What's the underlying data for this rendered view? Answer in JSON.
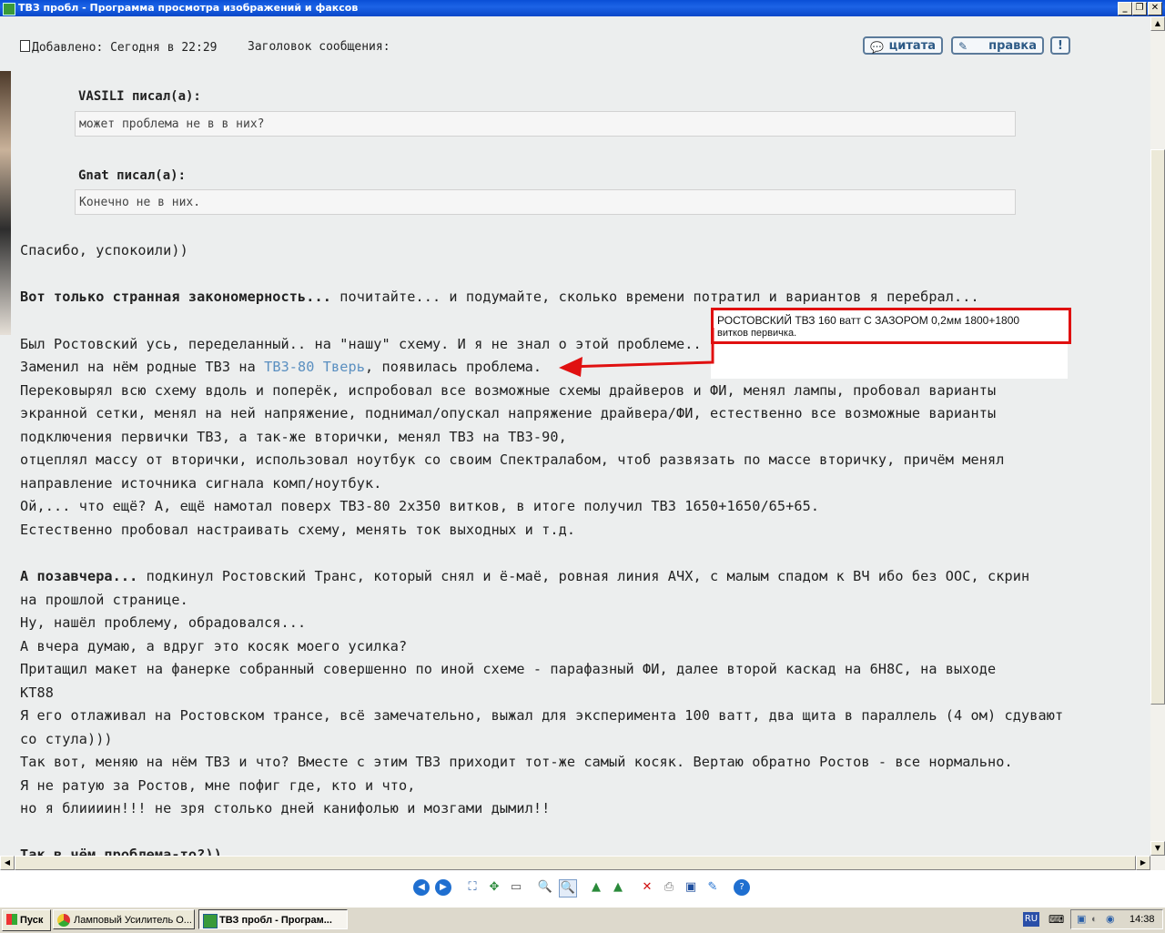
{
  "window": {
    "title": "ТВЗ пробл - Программа просмотра изображений и факсов",
    "min": "_",
    "restore": "❐",
    "close": "✕"
  },
  "post": {
    "added": "Добавлено: Сегодня в 22:29",
    "subject": "Заголовок сообщения:",
    "quote_btn": "цитата",
    "edit_btn": "правка",
    "report_btn": "!"
  },
  "quotes": [
    {
      "author": "VASILI писал(а):",
      "text": "может проблема не в в них?"
    },
    {
      "author": "Gnat писал(а):",
      "text": "Конечно не в них."
    }
  ],
  "body": {
    "l1": "Спасибо, успокоили))",
    "l2_bold": "Вот только странная закономерность...",
    "l2_rest": " почитайте... и подумайте, сколько времени потратил и вариантов я перебрал...",
    "l3": "Был Ростовский усь, переделанный.. на \"нашу\" схему. И я не знал о этой проблеме..",
    "l4_a": "Заменил на нём родные ТВЗ на ",
    "l4_link": "ТВЗ-80 Тверь",
    "l4_b": ", появилась проблема.",
    "l5": "Перековырял всю схему вдоль и поперёк, испробовал все возможные схемы драйверов и ФИ, менял лампы, пробовал варианты",
    "l6": "экранной сетки, менял на ней напряжение, поднимал/опускал напряжение драйвера/ФИ, естественно все возможные варианты",
    "l7": "подключения первички ТВЗ, а так-же вторички, менял ТВЗ на ТВЗ-90,",
    "l8": "отцеплял массу от вторички, использовал ноутбук со своим Спектралабом, чтоб развязать по массе вторичку, причём менял",
    "l9": "направление источника сигнала комп/ноутбук.",
    "l10": "Ой,... что ещё? А, ещё намотал поверх ТВЗ-80 2х350 витков, в итоге получил ТВЗ 1650+1650/65+65.",
    "l11": "Естественно пробовал настраивать схему, менять ток выходных и т.д.",
    "l12_bold": "А позавчера...",
    "l12_rest": " подкинул Ростовский Транс, который снял и ё-маё, ровная линия АЧХ, с малым спадом к ВЧ ибо без ООС, скрин",
    "l13": "на прошлой странице.",
    "l14": "Ну, нашёл проблему, обрадовался...",
    "l15": "А вчера думаю, а вдруг это косяк моего усилка?",
    "l16": "Притащил макет на фанерке собранный совершенно по иной схеме - парафазный ФИ, далее второй каскад на 6Н8С, на выходе",
    "l17": "КТ88",
    "l18": "Я его отлаживал на Ростовском трансе, всё замечательно, выжал для эксперимента 100 ватт, два щита в параллель (4 ом) сдувают",
    "l19": "со стула)))",
    "l20": "Так вот, меняю на нём ТВЗ и что? Вместе с этим ТВЗ приходит тот-же самый косяк. Вертаю обратно Ростов - все нормально.",
    "l21": "Я не ратую за Ростов, мне пофиг где, кто и что,",
    "l22": "но я блиииин!!! не зря столько дней канифолью и мозгами дымил!!",
    "l23_bold": "Так в чём проблема-то?))"
  },
  "annotation": {
    "line1": "РОСТОВСКИЙ  ТВЗ  160 ватт  С  ЗАЗОРОМ 0,2мм  1800+1800",
    "line2": "витков первичка.",
    "color": "#e01010"
  },
  "taskbar": {
    "start": "Пуск",
    "task1": "Ламповый Усилитель О...",
    "task2": "ТВЗ пробл - Програм...",
    "lang": "RU",
    "clock": "14:38"
  }
}
